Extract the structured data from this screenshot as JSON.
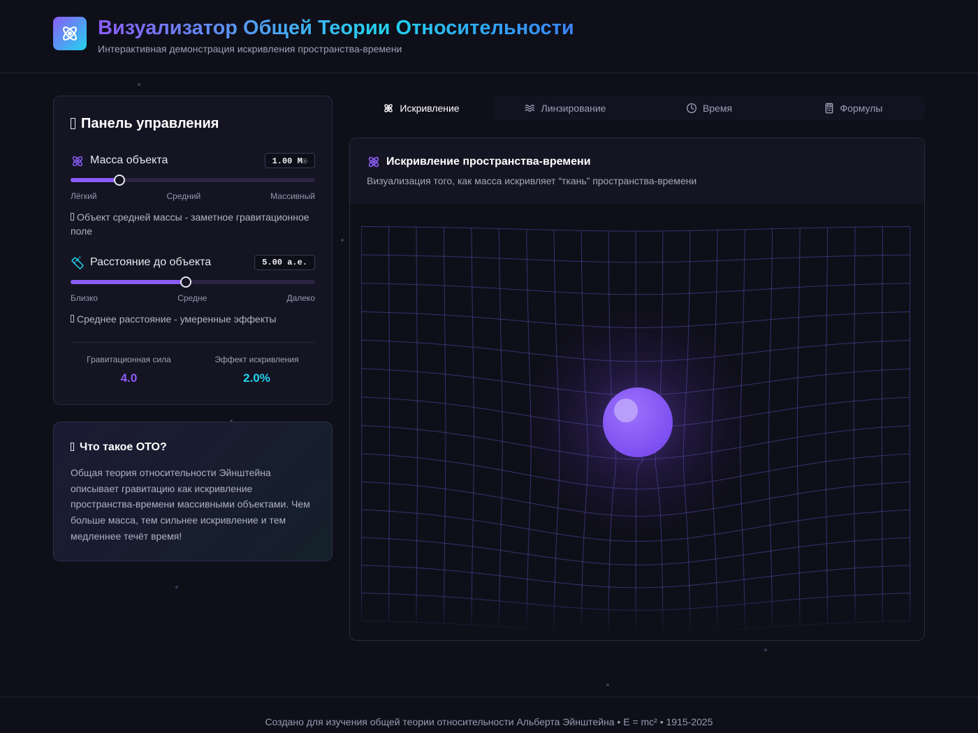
{
  "header": {
    "title": "Визуализатор Общей Теории Относительности",
    "subtitle": "Интерактивная демонстрация искривления пространства-времени",
    "logo_icon": "atom-icon"
  },
  "control_panel": {
    "title": "Панель управления",
    "title_icon": "missing-glyph-icon",
    "mass": {
      "label": "Масса объекта",
      "icon": "atom-icon",
      "value": "1.00 M☉",
      "slider_fraction": 0.2,
      "ticks": [
        "Лёгкий",
        "Средний",
        "Массивный"
      ],
      "hint": "Объект средней массы - заметное гравитационное поле"
    },
    "distance": {
      "label": "Расстояние до объекта",
      "icon": "ruler-icon",
      "value": "5.00 а.е.",
      "slider_fraction": 0.47,
      "ticks": [
        "Близко",
        "Средне",
        "Далеко"
      ],
      "hint": "Среднее расстояние - умеренные эффекты"
    },
    "stats": {
      "gravity_label": "Гравитационная сила",
      "gravity_value": "4.0",
      "curvature_label": "Эффект искривления",
      "curvature_value": "2.0%"
    }
  },
  "info_card": {
    "title": "Что такое ОТО?",
    "text": "Общая теория относительности Эйнштейна описывает гравитацию как искривление пространства-времени массивными объектами. Чем больше масса, тем сильнее искривление и тем медленнее течёт время!"
  },
  "tabs": [
    {
      "label": "Искривление",
      "icon": "atom-icon",
      "active": true
    },
    {
      "label": "Линзирование",
      "icon": "waves-icon",
      "active": false
    },
    {
      "label": "Время",
      "icon": "clock-icon",
      "active": false
    },
    {
      "label": "Формулы",
      "icon": "calculator-icon",
      "active": false
    }
  ],
  "visualization": {
    "title": "Искривление пространства-времени",
    "description": "Визуализация того, как масса искривляет “ткань” пространства-времени"
  },
  "footer": {
    "text": "Создано для изучения общей теории относительности Альберта Эйнштейна • E = mc² • 1915-2025"
  },
  "colors": {
    "accent_purple": "#8b5cf6",
    "accent_cyan": "#22d3ee",
    "background": "#0f0f1a"
  }
}
